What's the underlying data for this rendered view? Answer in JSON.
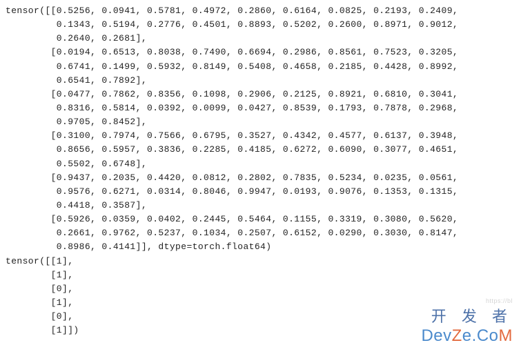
{
  "tensor1": {
    "prefix": "tensor(",
    "rows": [
      [
        "0.5256",
        "0.0941",
        "0.5781",
        "0.4972",
        "0.2860",
        "0.6164",
        "0.0825",
        "0.2193",
        "0.2409",
        "0.1343",
        "0.5194",
        "0.2776",
        "0.4501",
        "0.8893",
        "0.5202",
        "0.2600",
        "0.8971",
        "0.9012",
        "0.2640",
        "0.2681"
      ],
      [
        "0.0194",
        "0.6513",
        "0.8038",
        "0.7490",
        "0.6694",
        "0.2986",
        "0.8561",
        "0.7523",
        "0.3205",
        "0.6741",
        "0.1499",
        "0.5932",
        "0.8149",
        "0.5408",
        "0.4658",
        "0.2185",
        "0.4428",
        "0.8992",
        "0.6541",
        "0.7892"
      ],
      [
        "0.0477",
        "0.7862",
        "0.8356",
        "0.1098",
        "0.2906",
        "0.2125",
        "0.8921",
        "0.6810",
        "0.3041",
        "0.8316",
        "0.5814",
        "0.0392",
        "0.0099",
        "0.0427",
        "0.8539",
        "0.1793",
        "0.7878",
        "0.2968",
        "0.9705",
        "0.8452"
      ],
      [
        "0.3100",
        "0.7974",
        "0.7566",
        "0.6795",
        "0.3527",
        "0.4342",
        "0.4577",
        "0.6137",
        "0.3948",
        "0.8656",
        "0.5957",
        "0.3836",
        "0.2285",
        "0.4185",
        "0.6272",
        "0.6090",
        "0.3077",
        "0.4651",
        "0.5502",
        "0.6748"
      ],
      [
        "0.9437",
        "0.2035",
        "0.4420",
        "0.0812",
        "0.2802",
        "0.7835",
        "0.5234",
        "0.0235",
        "0.0561",
        "0.9576",
        "0.6271",
        "0.0314",
        "0.8046",
        "0.9947",
        "0.0193",
        "0.9076",
        "0.1353",
        "0.1315",
        "0.4418",
        "0.3587"
      ],
      [
        "0.5926",
        "0.0359",
        "0.0402",
        "0.2445",
        "0.5464",
        "0.1155",
        "0.3319",
        "0.3080",
        "0.5620",
        "0.2661",
        "0.9762",
        "0.5237",
        "0.1034",
        "0.2507",
        "0.6152",
        "0.0290",
        "0.3030",
        "0.8147",
        "0.8986",
        "0.4141"
      ]
    ],
    "dtype": "torch.float64"
  },
  "tensor2": {
    "prefix": "tensor(",
    "rows": [
      [
        "1"
      ],
      [
        "1"
      ],
      [
        "0"
      ],
      [
        "1"
      ],
      [
        "0"
      ],
      [
        "1"
      ]
    ]
  },
  "watermark": {
    "top": "开 发 者",
    "bottom_parts": [
      "Dev",
      "Z",
      "e.Co",
      "M"
    ],
    "tiny": "https://bl"
  },
  "chart_data": {
    "type": "table",
    "title": "Python/PyTorch tensor printout",
    "tensor1": {
      "shape": [
        6,
        20
      ],
      "dtype": "torch.float64",
      "data": [
        [
          0.5256,
          0.0941,
          0.5781,
          0.4972,
          0.286,
          0.6164,
          0.0825,
          0.2193,
          0.2409,
          0.1343,
          0.5194,
          0.2776,
          0.4501,
          0.8893,
          0.5202,
          0.26,
          0.8971,
          0.9012,
          0.264,
          0.2681
        ],
        [
          0.0194,
          0.6513,
          0.8038,
          0.749,
          0.6694,
          0.2986,
          0.8561,
          0.7523,
          0.3205,
          0.6741,
          0.1499,
          0.5932,
          0.8149,
          0.5408,
          0.4658,
          0.2185,
          0.4428,
          0.8992,
          0.6541,
          0.7892
        ],
        [
          0.0477,
          0.7862,
          0.8356,
          0.1098,
          0.2906,
          0.2125,
          0.8921,
          0.681,
          0.3041,
          0.8316,
          0.5814,
          0.0392,
          0.0099,
          0.0427,
          0.8539,
          0.1793,
          0.7878,
          0.2968,
          0.9705,
          0.8452
        ],
        [
          0.31,
          0.7974,
          0.7566,
          0.6795,
          0.3527,
          0.4342,
          0.4577,
          0.6137,
          0.3948,
          0.8656,
          0.5957,
          0.3836,
          0.2285,
          0.4185,
          0.6272,
          0.609,
          0.3077,
          0.4651,
          0.5502,
          0.6748
        ],
        [
          0.9437,
          0.2035,
          0.442,
          0.0812,
          0.2802,
          0.7835,
          0.5234,
          0.0235,
          0.0561,
          0.9576,
          0.6271,
          0.0314,
          0.8046,
          0.9947,
          0.0193,
          0.9076,
          0.1353,
          0.1315,
          0.4418,
          0.3587
        ],
        [
          0.5926,
          0.0359,
          0.0402,
          0.2445,
          0.5464,
          0.1155,
          0.3319,
          0.308,
          0.562,
          0.2661,
          0.9762,
          0.5237,
          0.1034,
          0.2507,
          0.6152,
          0.029,
          0.303,
          0.8147,
          0.8986,
          0.4141
        ]
      ]
    },
    "tensor2": {
      "shape": [
        6,
        1
      ],
      "data": [
        [
          1
        ],
        [
          1
        ],
        [
          0
        ],
        [
          1
        ],
        [
          0
        ],
        [
          1
        ]
      ]
    }
  }
}
